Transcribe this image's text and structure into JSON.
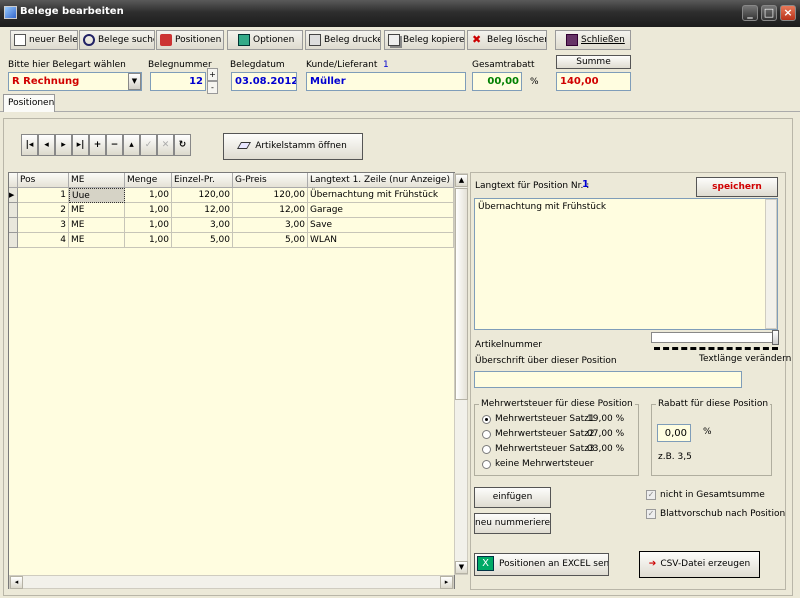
{
  "window": {
    "title": "Belege bearbeiten"
  },
  "toolbar": {
    "new": "neuer Beleg",
    "search": "Belege suchen",
    "positions": "Positionen",
    "options": "Optionen",
    "print": "Beleg drucken",
    "copy": "Beleg kopieren",
    "delete": "Beleg löschen",
    "close": "Schließen"
  },
  "header": {
    "belegart_label": "Bitte hier Belegart wählen",
    "belegart_value": "R  Rechnung",
    "belegnummer_label": "Belegnummer",
    "belegnummer_value": "12",
    "belegdatum_label": "Belegdatum",
    "belegdatum_value": "03.08.2012",
    "kunde_label": "Kunde/Lieferant",
    "kunde_id": "1",
    "kunde_value": "Müller",
    "rabatt_label": "Gesamtrabatt",
    "rabatt_value": "00,00",
    "rabatt_unit": "%",
    "summe_label": "Summe",
    "summe_value": "140,00"
  },
  "tabs": {
    "positionen": "Positionen"
  },
  "artikelstamm_button": "Artikelstamm öffnen",
  "grid": {
    "columns": [
      "Pos",
      "ME",
      "Menge",
      "Einzel-Pr.",
      "G-Preis",
      "Langtext 1. Zeile (nur Anzeige)"
    ],
    "rows": [
      {
        "pos": "1",
        "me": "Uue",
        "menge": "1,00",
        "einzel": "120,00",
        "gpreis": "120,00",
        "text": "Übernachtung mit Frühstück"
      },
      {
        "pos": "2",
        "me": "ME",
        "menge": "1,00",
        "einzel": "12,00",
        "gpreis": "12,00",
        "text": "Garage"
      },
      {
        "pos": "3",
        "me": "ME",
        "menge": "1,00",
        "einzel": "3,00",
        "gpreis": "3,00",
        "text": "Save"
      },
      {
        "pos": "4",
        "me": "ME",
        "menge": "1,00",
        "einzel": "5,00",
        "gpreis": "5,00",
        "text": "WLAN"
      }
    ]
  },
  "detail": {
    "langtext_label": "Langtext für  Position Nr. :",
    "position_nr": "1",
    "save_button": "speichern",
    "langtext_value": "Übernachtung mit Frühstück",
    "artikelnummer_label": "Artikelnummer",
    "textlaenge_label": "Textlänge verändern",
    "ueberschrift_label": "Überschrift über dieser Position",
    "mwst_legend": "Mehrwertsteuer für diese Position",
    "mwst_options": [
      {
        "label": "Mehrwertsteuer Satz1",
        "rate": "19,00 %"
      },
      {
        "label": "Mehrwertsteuer Satz2",
        "rate": "07,00 %"
      },
      {
        "label": "Mehrwertsteuer Satz3",
        "rate": "03,00 %"
      },
      {
        "label": "keine Mehrwertsteuer",
        "rate": ""
      }
    ],
    "rabatt_legend": "Rabatt für diese Position",
    "rabatt_value": "0,00",
    "rabatt_unit": "%",
    "rabatt_example": "z.B. 3,5",
    "insert_button": "einfügen",
    "renumber_button": "neu nummerieren",
    "not_in_total": "nicht in Gesamtsumme",
    "page_break": "Blattvorschub nach Position",
    "excel_button": "Positionen an EXCEL senden",
    "csv_button": "CSV-Datei erzeugen"
  },
  "colors": {
    "accent_red": "#d00000",
    "accent_blue": "#0000d0",
    "field_bg": "#fffde0"
  }
}
